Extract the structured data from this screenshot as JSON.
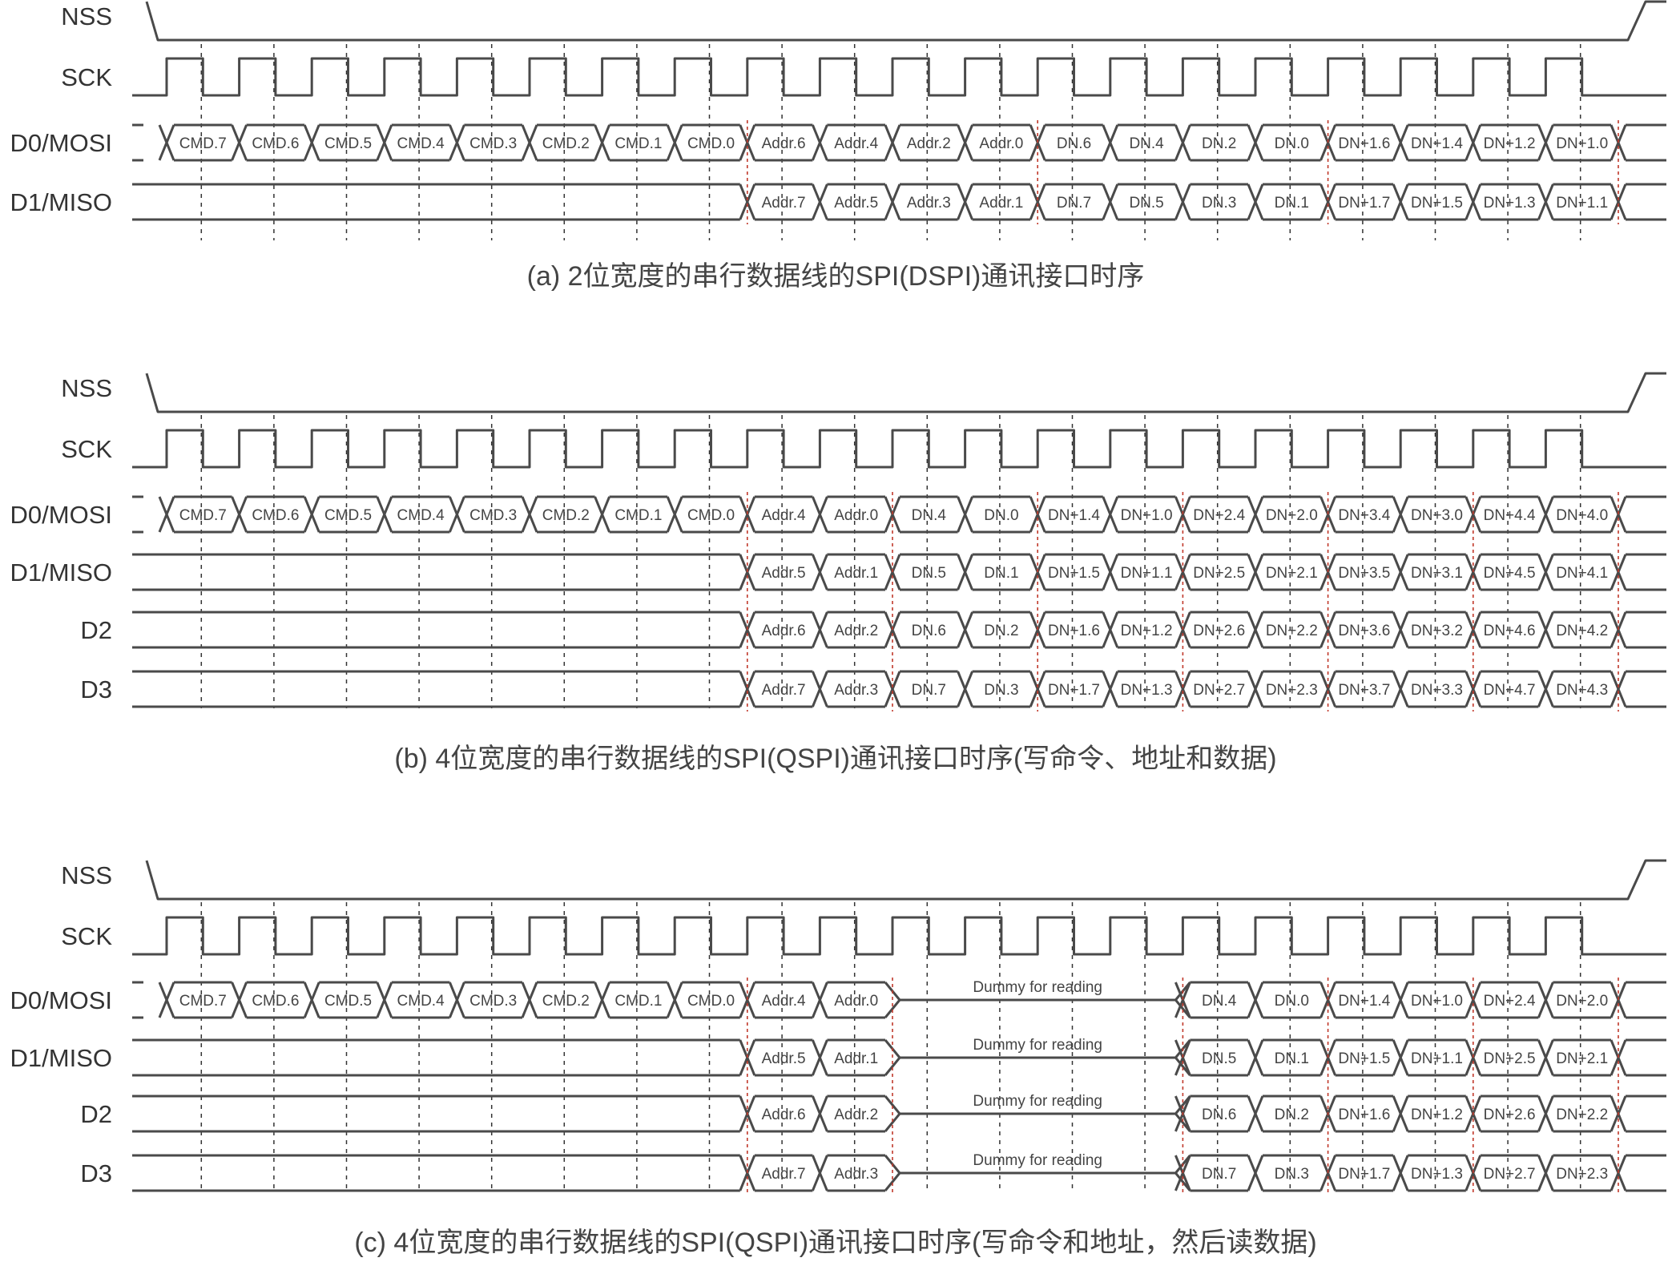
{
  "colors": {
    "line": "#4a4a4a",
    "tick": "#333333",
    "boundary": "#c0392b",
    "text": "#333333"
  },
  "panels": [
    {
      "id": "a",
      "caption": "(a)  2位宽度的串行数据线的SPI(DSPI)通讯接口时序",
      "cycles": 20,
      "signals": [
        {
          "label": "NSS",
          "kind": "nss"
        },
        {
          "label": "SCK",
          "kind": "clock"
        },
        {
          "label": "D0/MOSI",
          "kind": "bus",
          "cells": [
            "CMD.7",
            "CMD.6",
            "CMD.5",
            "CMD.4",
            "CMD.3",
            "CMD.2",
            "CMD.1",
            "CMD.0",
            "Addr.6",
            "Addr.4",
            "Addr.2",
            "Addr.0",
            "DN.6",
            "DN.4",
            "DN.2",
            "DN.0",
            "DN+1.6",
            "DN+1.4",
            "DN+1.2",
            "DN+1.0"
          ]
        },
        {
          "label": "D1/MISO",
          "kind": "bus",
          "cells": [
            "",
            "",
            "",
            "",
            "",
            "",
            "",
            "",
            "Addr.7",
            "Addr.5",
            "Addr.3",
            "Addr.1",
            "DN.7",
            "DN.5",
            "DN.3",
            "DN.1",
            "DN+1.7",
            "DN+1.5",
            "DN+1.3",
            "DN+1.1"
          ]
        }
      ]
    },
    {
      "id": "b",
      "caption": "(b)  4位宽度的串行数据线的SPI(QSPI)通讯接口时序(写命令、地址和数据)",
      "cycles": 20,
      "signals": [
        {
          "label": "NSS",
          "kind": "nss"
        },
        {
          "label": "SCK",
          "kind": "clock"
        },
        {
          "label": "D0/MOSI",
          "kind": "bus",
          "cells": [
            "CMD.7",
            "CMD.6",
            "CMD.5",
            "CMD.4",
            "CMD.3",
            "CMD.2",
            "CMD.1",
            "CMD.0",
            "Addr.4",
            "Addr.0",
            "DN.4",
            "DN.0",
            "DN+1.4",
            "DN+1.0",
            "DN+2.4",
            "DN+2.0",
            "DN+3.4",
            "DN+3.0",
            "DN+4.4",
            "DN+4.0"
          ]
        },
        {
          "label": "D1/MISO",
          "kind": "bus",
          "cells": [
            "",
            "",
            "",
            "",
            "",
            "",
            "",
            "",
            "Addr.5",
            "Addr.1",
            "DN.5",
            "DN.1",
            "DN+1.5",
            "DN+1.1",
            "DN+2.5",
            "DN+2.1",
            "DN+3.5",
            "DN+3.1",
            "DN+4.5",
            "DN+4.1"
          ]
        },
        {
          "label": "D2",
          "kind": "bus",
          "cells": [
            "",
            "",
            "",
            "",
            "",
            "",
            "",
            "",
            "Addr.6",
            "Addr.2",
            "DN.6",
            "DN.2",
            "DN+1.6",
            "DN+1.2",
            "DN+2.6",
            "DN+2.2",
            "DN+3.6",
            "DN+3.2",
            "DN+4.6",
            "DN+4.2"
          ]
        },
        {
          "label": "D3",
          "kind": "bus",
          "cells": [
            "",
            "",
            "",
            "",
            "",
            "",
            "",
            "",
            "Addr.7",
            "Addr.3",
            "DN.7",
            "DN.3",
            "DN+1.7",
            "DN+1.3",
            "DN+2.7",
            "DN+2.3",
            "DN+3.7",
            "DN+3.3",
            "DN+4.7",
            "DN+4.3"
          ]
        }
      ]
    },
    {
      "id": "c",
      "caption": "(c)  4位宽度的串行数据线的SPI(QSPI)通讯接口时序(写命令和地址，然后读数据)",
      "cycles": 20,
      "signals": [
        {
          "label": "NSS",
          "kind": "nss"
        },
        {
          "label": "SCK",
          "kind": "clock"
        },
        {
          "label": "D0/MOSI",
          "kind": "bus",
          "dummy": "Dummy  for reading",
          "cells": [
            "CMD.7",
            "CMD.6",
            "CMD.5",
            "CMD.4",
            "CMD.3",
            "CMD.2",
            "CMD.1",
            "CMD.0",
            "Addr.4",
            "Addr.0",
            "~",
            "~",
            "~",
            "~",
            "DN.4",
            "DN.0",
            "DN+1.4",
            "DN+1.0",
            "DN+2.4",
            "DN+2.0"
          ]
        },
        {
          "label": "D1/MISO",
          "kind": "bus",
          "dummy": "Dummy  for reading",
          "cells": [
            "",
            "",
            "",
            "",
            "",
            "",
            "",
            "",
            "Addr.5",
            "Addr.1",
            "~",
            "~",
            "~",
            "~",
            "DN.5",
            "DN.1",
            "DN+1.5",
            "DN+1.1",
            "DN+2.5",
            "DN+2.1"
          ]
        },
        {
          "label": "D2",
          "kind": "bus",
          "dummy": "Dummy  for reading",
          "cells": [
            "",
            "",
            "",
            "",
            "",
            "",
            "",
            "",
            "Addr.6",
            "Addr.2",
            "~",
            "~",
            "~",
            "~",
            "DN.6",
            "DN.2",
            "DN+1.6",
            "DN+1.2",
            "DN+2.6",
            "DN+2.2"
          ]
        },
        {
          "label": "D3",
          "kind": "bus",
          "dummy": "Dummy  for reading",
          "cells": [
            "",
            "",
            "",
            "",
            "",
            "",
            "",
            "",
            "Addr.7",
            "Addr.3",
            "~",
            "~",
            "~",
            "~",
            "DN.7",
            "DN.3",
            "DN+1.7",
            "DN+1.3",
            "DN+2.7",
            "DN+2.3"
          ]
        }
      ]
    }
  ]
}
